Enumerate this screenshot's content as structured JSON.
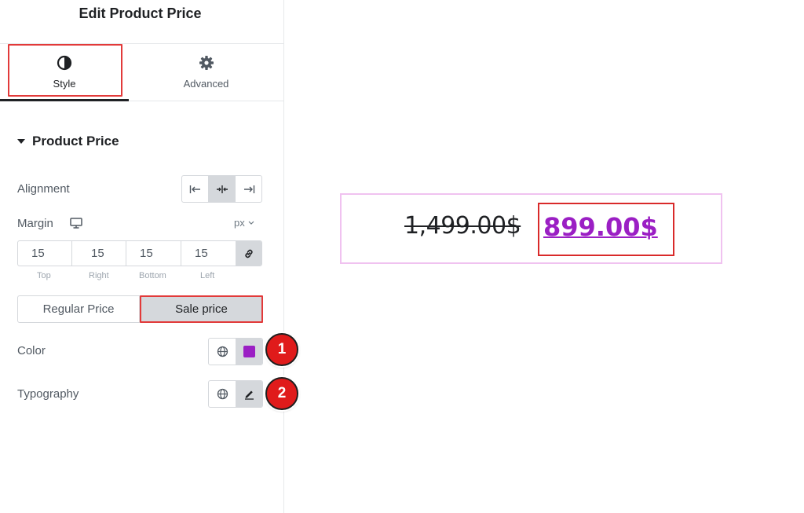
{
  "panel": {
    "title": "Edit Product Price",
    "tabs": [
      {
        "label": "Style",
        "icon": "contrast-icon",
        "active": true
      },
      {
        "label": "Advanced",
        "icon": "gear-icon",
        "active": false
      }
    ]
  },
  "section": {
    "title": "Product Price"
  },
  "alignment": {
    "label": "Alignment",
    "options": [
      "align-left-icon",
      "align-center-icon",
      "align-right-icon"
    ],
    "selected": "align-center-icon"
  },
  "margin": {
    "label": "Margin",
    "unit": "px",
    "values": [
      "15",
      "15",
      "15",
      "15"
    ],
    "sides": [
      "Top",
      "Right",
      "Bottom",
      "Left"
    ]
  },
  "price_toggle": {
    "regular_label": "Regular Price",
    "sale_label": "Sale price",
    "selected": "Sale price"
  },
  "color": {
    "label": "Color",
    "value": "#9b1fc4"
  },
  "typography": {
    "label": "Typography"
  },
  "badges": [
    "1",
    "2"
  ],
  "preview": {
    "regular_price": "1,499.00$",
    "sale_price": "899.00$"
  },
  "colors": {
    "highlight": "#e23a3a",
    "accent_purple": "#9b1fc4",
    "badge_red": "#e01b1b"
  }
}
